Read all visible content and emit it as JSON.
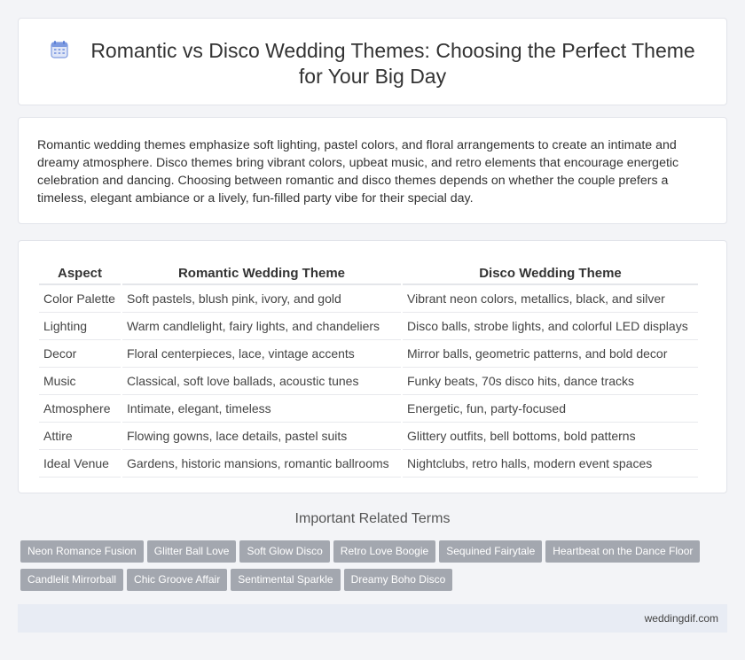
{
  "header": {
    "title": "Romantic vs Disco Wedding Themes: Choosing the Perfect Theme for Your Big Day",
    "icon": "calendar-icon",
    "icon_color": "#5b7fd6"
  },
  "intro": {
    "text": "Romantic wedding themes emphasize soft lighting, pastel colors, and floral arrangements to create an intimate and dreamy atmosphere. Disco themes bring vibrant colors, upbeat music, and retro elements that encourage energetic celebration and dancing. Choosing between romantic and disco themes depends on whether the couple prefers a timeless, elegant ambiance or a lively, fun-filled party vibe for their special day."
  },
  "table": {
    "headers": [
      "Aspect",
      "Romantic Wedding Theme",
      "Disco Wedding Theme"
    ],
    "rows": [
      [
        "Color Palette",
        "Soft pastels, blush pink, ivory, and gold",
        "Vibrant neon colors, metallics, black, and silver"
      ],
      [
        "Lighting",
        "Warm candlelight, fairy lights, and chandeliers",
        "Disco balls, strobe lights, and colorful LED displays"
      ],
      [
        "Decor",
        "Floral centerpieces, lace, vintage accents",
        "Mirror balls, geometric patterns, and bold decor"
      ],
      [
        "Music",
        "Classical, soft love ballads, acoustic tunes",
        "Funky beats, 70s disco hits, dance tracks"
      ],
      [
        "Atmosphere",
        "Intimate, elegant, timeless",
        "Energetic, fun, party-focused"
      ],
      [
        "Attire",
        "Flowing gowns, lace details, pastel suits",
        "Glittery outfits, bell bottoms, bold patterns"
      ],
      [
        "Ideal Venue",
        "Gardens, historic mansions, romantic ballrooms",
        "Nightclubs, retro halls, modern event spaces"
      ]
    ]
  },
  "related": {
    "title": "Important Related Terms",
    "tags": [
      "Neon Romance Fusion",
      "Glitter Ball Love",
      "Soft Glow Disco",
      "Retro Love Boogie",
      "Sequined Fairytale",
      "Heartbeat on the Dance Floor",
      "Candlelit Mirrorball",
      "Chic Groove Affair",
      "Sentimental Sparkle",
      "Dreamy Boho Disco"
    ]
  },
  "footer": {
    "site": "weddingdif.com"
  }
}
